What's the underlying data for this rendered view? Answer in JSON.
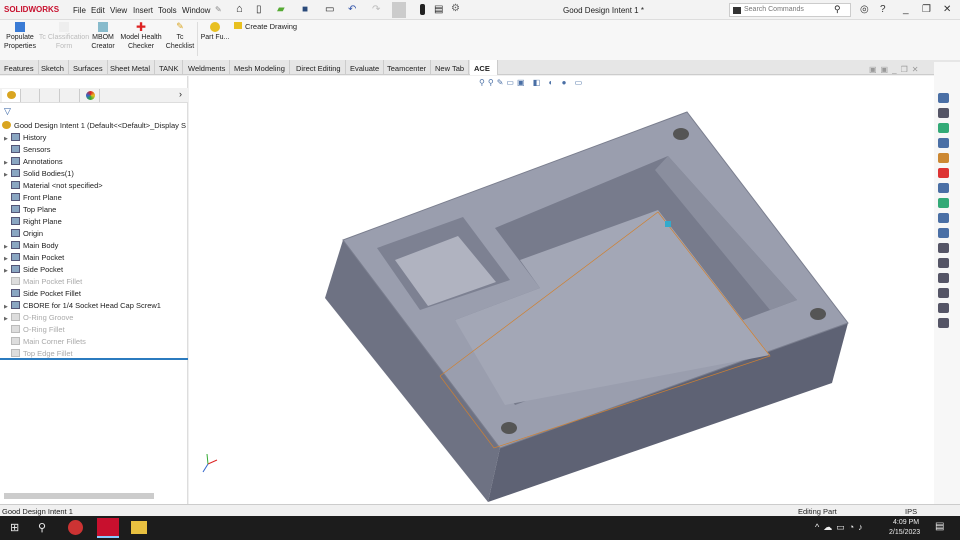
{
  "app": {
    "logo": "SOLIDWORKS",
    "title": "Good Design Intent 1 *"
  },
  "menu": [
    "File",
    "Edit",
    "View",
    "Insert",
    "Tools",
    "Window"
  ],
  "search": {
    "placeholder": "Search Commands"
  },
  "commands": [
    {
      "label1": "Populate",
      "label2": "Properties",
      "color": "#3a7bd5"
    },
    {
      "label1": "Tc Classification",
      "label2": "Form",
      "color": "#ccc",
      "disabled": true
    },
    {
      "label1": "MBOM",
      "label2": "Creator",
      "color": "#6a9"
    },
    {
      "label1": "Model Health",
      "label2": "Checker",
      "color": "#d22"
    },
    {
      "label1": "Tc",
      "label2": "Checklist",
      "color": "#d9a520"
    },
    {
      "label1": "Part Fu...",
      "label2": "",
      "color": "#e8c020"
    }
  ],
  "create_drawing": "Create Drawing",
  "tabs": [
    "Features",
    "Sketch",
    "Surfaces",
    "Sheet Metal",
    "TANK",
    "Weldments",
    "Mesh Modeling",
    "Direct Editing",
    "Evaluate",
    "Teamcenter",
    "New Tab",
    "ACE"
  ],
  "tree": {
    "root": "Good Design Intent 1  (Default<<Default>_Display S",
    "items": [
      {
        "label": "History",
        "arrow": true
      },
      {
        "label": "Sensors"
      },
      {
        "label": "Annotations",
        "arrow": true
      },
      {
        "label": "Solid Bodies(1)",
        "arrow": true
      },
      {
        "label": "Material <not specified>"
      },
      {
        "label": "Front Plane"
      },
      {
        "label": "Top Plane"
      },
      {
        "label": "Right Plane"
      },
      {
        "label": "Origin"
      },
      {
        "label": "Main Body",
        "arrow": true
      },
      {
        "label": "Main Pocket",
        "arrow": true
      },
      {
        "label": "Side Pocket",
        "arrow": true
      },
      {
        "label": "Main Pocket Fillet",
        "dim": true
      },
      {
        "label": "Side Pocket Fillet"
      },
      {
        "label": "CBORE for 1/4 Socket Head Cap Screw1",
        "arrow": true
      },
      {
        "label": "O-Ring Groove",
        "arrow": true,
        "dim": true
      },
      {
        "label": "O-Ring Fillet",
        "dim": true
      },
      {
        "label": "Main Corner Fillets",
        "dim": true
      },
      {
        "label": "Top Edge Fillet",
        "dim": true
      }
    ]
  },
  "status": {
    "left": "Good Design Intent 1",
    "mode": "Editing Part",
    "units": "IPS"
  },
  "taskbar": {
    "time": "4:09 PM",
    "date": "2/15/2023"
  }
}
